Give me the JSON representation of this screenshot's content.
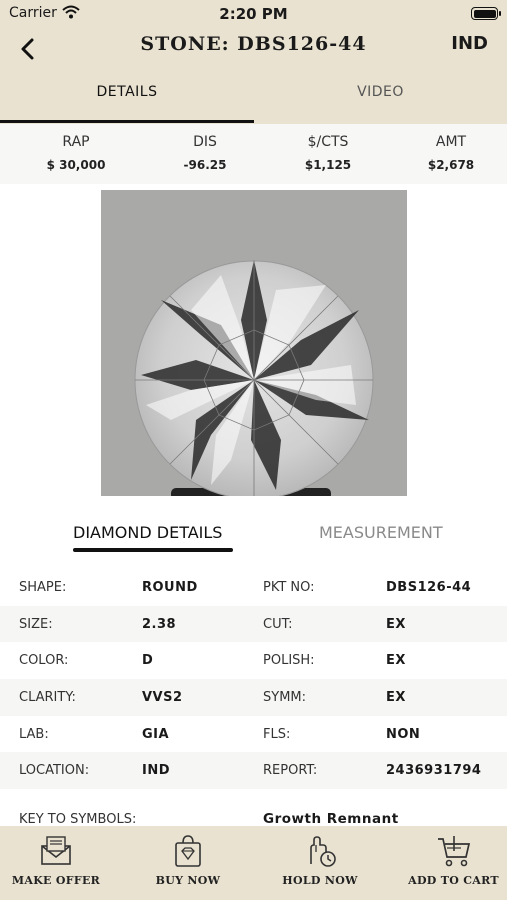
{
  "status": {
    "carrier": "Carrier",
    "time": "2:20 PM"
  },
  "header": {
    "title": "STONE: DBS126-44",
    "location_button": "IND"
  },
  "top_tabs": {
    "details": "DETAILS",
    "video": "VIDEO"
  },
  "prices": [
    {
      "label": "RAP",
      "value": "$ 30,000"
    },
    {
      "label": "DIS",
      "value": "-96.25"
    },
    {
      "label": "$/CTS",
      "value": "$1,125"
    },
    {
      "label": "AMT",
      "value": "$2,678"
    }
  ],
  "sub_tabs": {
    "diamond": "DIAMOND DETAILS",
    "measurement": "MEASUREMENT"
  },
  "details": [
    {
      "k1": "SHAPE:",
      "v1": "ROUND",
      "k2": "PKT NO:",
      "v2": "DBS126-44"
    },
    {
      "k1": "SIZE:",
      "v1": "2.38",
      "k2": "CUT:",
      "v2": "EX"
    },
    {
      "k1": "COLOR:",
      "v1": "D",
      "k2": "POLISH:",
      "v2": "EX"
    },
    {
      "k1": "CLARITY:",
      "v1": "VVS2",
      "k2": "SYMM:",
      "v2": "EX"
    },
    {
      "k1": "LAB:",
      "v1": "GIA",
      "k2": "FLS:",
      "v2": "NON"
    },
    {
      "k1": "LOCATION:",
      "v1": "IND",
      "k2": "REPORT:",
      "v2": "2436931794"
    }
  ],
  "key_to_symbols": {
    "label": "KEY TO SYMBOLS:",
    "value": "Growth Remnant"
  },
  "bottom_bar": {
    "make_offer": "MAKE OFFER",
    "buy_now": "BUY NOW",
    "hold_now": "HOLD NOW",
    "add_to_cart": "ADD TO CART"
  },
  "colors": {
    "header_bg": "#e9e2d0",
    "image_bg": "#a9a9a8"
  }
}
